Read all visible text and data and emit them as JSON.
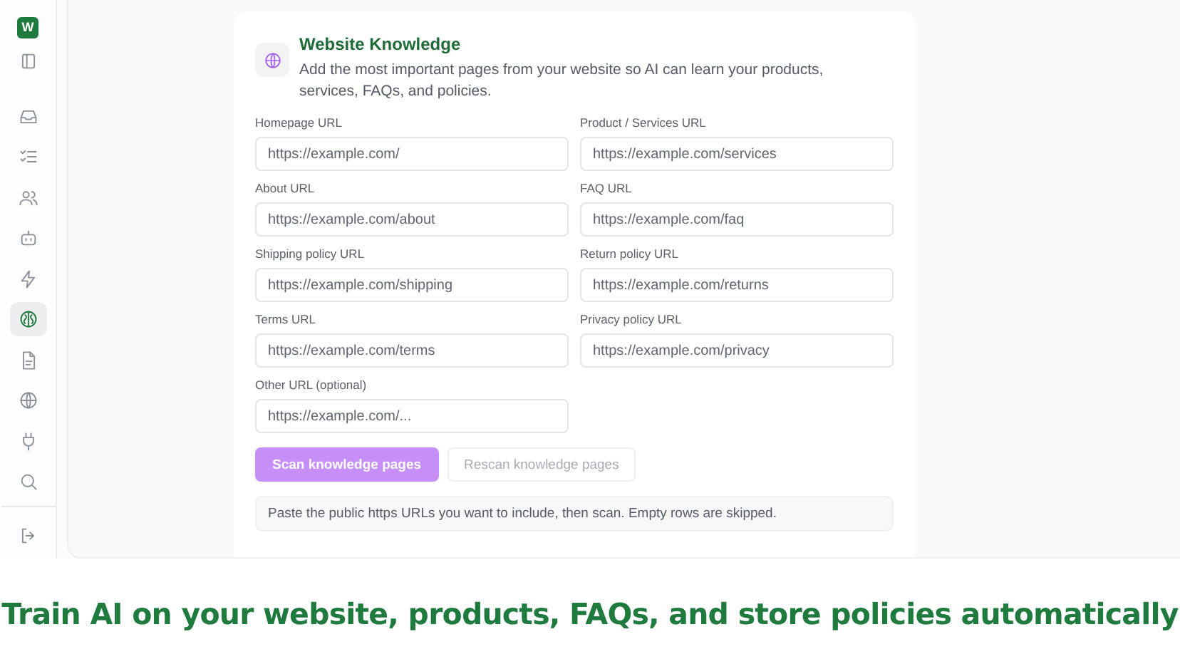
{
  "sidebar": {
    "logo": "W",
    "items": [
      {
        "kind": "panel",
        "selected": false
      },
      {
        "kind": "inbox",
        "selected": false
      },
      {
        "kind": "checklist",
        "selected": false
      },
      {
        "kind": "users",
        "selected": false
      },
      {
        "kind": "bot",
        "selected": false
      },
      {
        "kind": "bolt",
        "selected": false
      },
      {
        "kind": "brain",
        "selected": true
      },
      {
        "kind": "document",
        "selected": false
      },
      {
        "kind": "globe",
        "selected": false
      },
      {
        "kind": "plug",
        "selected": false
      },
      {
        "kind": "search",
        "selected": false
      }
    ],
    "footer_item": {
      "kind": "logout",
      "selected": false
    }
  },
  "card": {
    "title": "Website Knowledge",
    "description": "Add the most important pages from your website so AI can learn your products, services, FAQs, and policies.",
    "fields": [
      {
        "label": "Homepage URL",
        "placeholder": "https://example.com/"
      },
      {
        "label": "Product / Services URL",
        "placeholder": "https://example.com/services"
      },
      {
        "label": "About URL",
        "placeholder": "https://example.com/about"
      },
      {
        "label": "FAQ URL",
        "placeholder": "https://example.com/faq"
      },
      {
        "label": "Shipping policy URL",
        "placeholder": "https://example.com/shipping"
      },
      {
        "label": "Return policy URL",
        "placeholder": "https://example.com/returns"
      },
      {
        "label": "Terms URL",
        "placeholder": "https://example.com/terms"
      },
      {
        "label": "Privacy policy URL",
        "placeholder": "https://example.com/privacy"
      },
      {
        "label": "Other URL (optional)",
        "placeholder": "https://example.com/..."
      }
    ],
    "buttons": [
      {
        "label": "Scan knowledge pages",
        "kind": "primary",
        "disabled": false
      },
      {
        "label": "Rescan knowledge pages",
        "kind": "secondary",
        "disabled": true
      }
    ],
    "note": "Paste the public https URLs you want to include, then scan. Empty rows are skipped."
  },
  "caption": "Train AI on your website, products, FAQs, and store policies automatically"
}
